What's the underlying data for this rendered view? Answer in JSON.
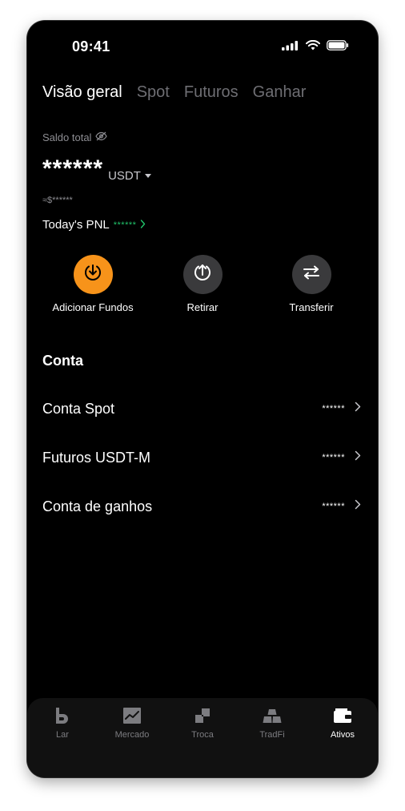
{
  "status_bar": {
    "time": "09:41"
  },
  "tabs": [
    {
      "label": "Visão geral",
      "active": true
    },
    {
      "label": "Spot",
      "active": false
    },
    {
      "label": "Futuros",
      "active": false
    },
    {
      "label": "Ganhar",
      "active": false
    }
  ],
  "balance": {
    "label": "Saldo total",
    "value": "******",
    "currency": "USDT",
    "approx": "≈$******",
    "pnl_label": "Today's PNL",
    "pnl_value": "******"
  },
  "actions": [
    {
      "label": "Adicionar Fundos",
      "icon": "download-icon",
      "color": "#f7931a"
    },
    {
      "label": "Retirar",
      "icon": "upload-icon",
      "color": "#3a3a3c"
    },
    {
      "label": "Transferir",
      "icon": "transfer-icon",
      "color": "#3a3a3c"
    }
  ],
  "accounts": {
    "title": "Conta",
    "items": [
      {
        "name": "Conta Spot",
        "value": "******"
      },
      {
        "name": "Futuros USDT-M",
        "value": "******"
      },
      {
        "name": "Conta de ganhos",
        "value": "******"
      }
    ]
  },
  "bottom_nav": [
    {
      "label": "Lar",
      "icon": "home-icon",
      "active": false
    },
    {
      "label": "Mercado",
      "icon": "market-chart-icon",
      "active": false
    },
    {
      "label": "Troca",
      "icon": "trade-icon",
      "active": false
    },
    {
      "label": "TradFi",
      "icon": "gold-bars-icon",
      "active": false
    },
    {
      "label": "Ativos",
      "icon": "wallet-icon",
      "active": true
    }
  ],
  "colors": {
    "accent": "#f7931a",
    "positive": "#21c46b",
    "background": "#000000",
    "muted": "#6e6e73"
  }
}
